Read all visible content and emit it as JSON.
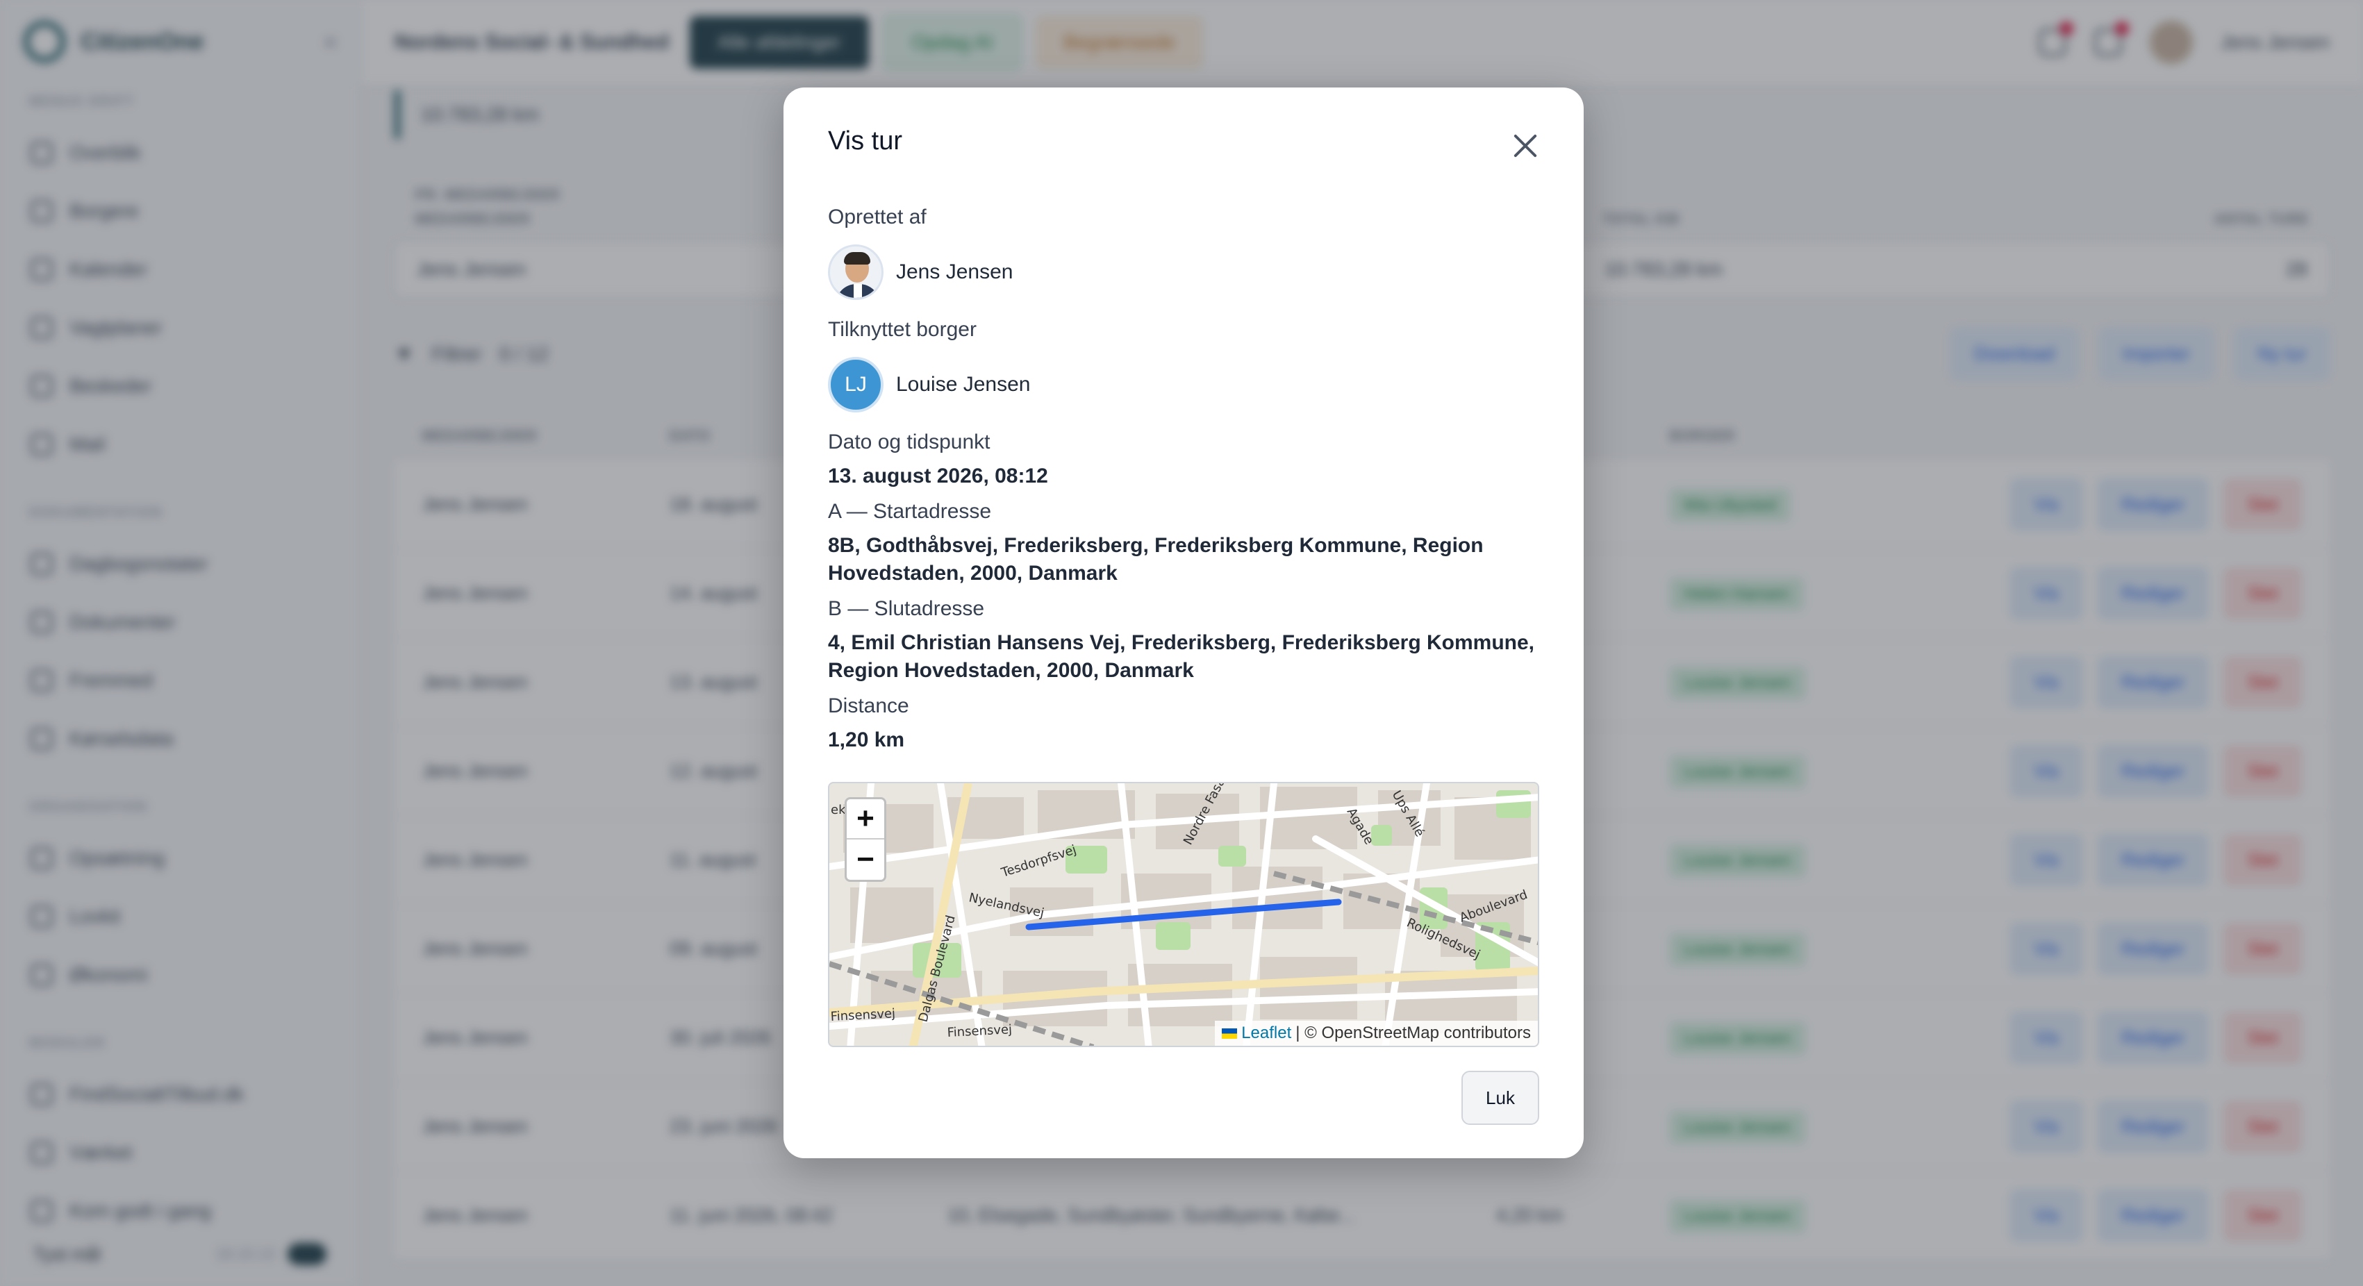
{
  "background": {
    "brand": "CitizenOne",
    "sidebar": {
      "section_1": "MENUS DRIFT",
      "items_1": [
        "Overblik",
        "Borgere",
        "Kalender",
        "Vagtplaner",
        "Beskeder",
        "Mail"
      ],
      "section_2": "DOKUMENTATION",
      "items_2": [
        "Dagbogsnotater",
        "Dokumenter",
        "Fremmed",
        "Kørselsdata"
      ],
      "section_3": "ORGANISATION",
      "items_3": [
        "Opsætning",
        "Lovkit",
        "Økonomi"
      ],
      "section_4": "MODULER",
      "items_4": [
        "FindSocialtTilbud.dk",
        "Værket",
        "Kom godt i gang"
      ],
      "bottom_label": "Tyst mål",
      "version": "18.10.13"
    },
    "topbar": {
      "org": "Nordens Social- & Sundhed",
      "dark_button": "Alle afdelinger",
      "green_button": "Opdag AI",
      "orange_button": "Begrænsede",
      "user": "Jens Jensen"
    },
    "km_total": "10.783,28 km",
    "summary": {
      "head_1": "PR. MEDARBEJDER",
      "head_label": "MEDARBEJDER",
      "head_total": "TOTAL KM",
      "head_count": "ANTAL TURE",
      "row_name": "Jens Jensen",
      "row_total": "10.783,28 km",
      "row_count": "28"
    },
    "filters": {
      "label": "Filtrer",
      "count": "0 / 12",
      "download": "Download",
      "import": "Importer",
      "new": "Ny tur"
    },
    "table": {
      "head": [
        "MEDARBEJDER",
        "DATO",
        "",
        "",
        "BORGER"
      ],
      "rows": [
        {
          "who": "Jens Jensen",
          "date": "18. august",
          "addr": "",
          "km": "",
          "borger": "Mia Ubysted"
        },
        {
          "who": "Jens Jensen",
          "date": "14. august",
          "addr": "",
          "km": "",
          "borger": "Helen Hansen"
        },
        {
          "who": "Jens Jensen",
          "date": "13. august",
          "addr": "",
          "km": "",
          "borger": "Louise Jensen"
        },
        {
          "who": "Jens Jensen",
          "date": "12. august",
          "addr": "",
          "km": "",
          "borger": "Louise Jensen"
        },
        {
          "who": "Jens Jensen",
          "date": "11. august",
          "addr": "",
          "km": "",
          "borger": "Louise Jensen"
        },
        {
          "who": "Jens Jensen",
          "date": "09. august",
          "addr": "",
          "km": "",
          "borger": "Louise Jensen"
        },
        {
          "who": "Jens Jensen",
          "date": "30. juli 2026",
          "addr": "",
          "km": "",
          "borger": "Louise Jensen"
        },
        {
          "who": "Jens Jensen",
          "date": "23. juni 2026",
          "addr": "",
          "km": "",
          "borger": "Louise Jensen"
        },
        {
          "who": "Jens Jensen",
          "date": "11. juni 2026, 08:42",
          "addr": "10, Elsegade, Sundbyøster, Sundbyerne, Købe...",
          "km": "4,20 km",
          "borger": "Louise Jensen"
        }
      ],
      "view": "Vis",
      "edit": "Rediger",
      "delete": "Slet"
    }
  },
  "modal": {
    "title": "Vis tur",
    "created_by_label": "Oprettet af",
    "created_by_name": "Jens Jensen",
    "linked_citizen_label": "Tilknyttet borger",
    "linked_citizen_initials": "LJ",
    "linked_citizen_name": "Louise Jensen",
    "datetime_label": "Dato og tidspunkt",
    "datetime_value": "13. august 2026, 08:12",
    "start_label": "A — Startadresse",
    "start_value": "8B, Godthåbsvej, Frederiksberg, Frederiksberg Kommune, Region Hovedstaden, 2000, Danmark",
    "end_label": "B — Slutadresse",
    "end_value": "4, Emil Christian Hansens Vej, Frederiksberg, Frederiksberg Kommune, Region Hovedstaden, 2000, Danmark",
    "distance_label": "Distance",
    "distance_value": "1,20 km",
    "map": {
      "zoom_in": "+",
      "zoom_out": "−",
      "attribution_link": "Leaflet",
      "attribution_text": "| © OpenStreetMap contributors",
      "streets": [
        "Tesdorpfsvej",
        "Nyelandsvej",
        "Dalgas Boulevard",
        "Finsensvej",
        "Rolighedsvej",
        "Nordre Fasanvej",
        "Agade",
        "Aboulevard",
        "Ups Allé",
        "Finsensvej",
        "eken"
      ],
      "route_color": "#2563eb"
    },
    "close_button": "Luk"
  }
}
